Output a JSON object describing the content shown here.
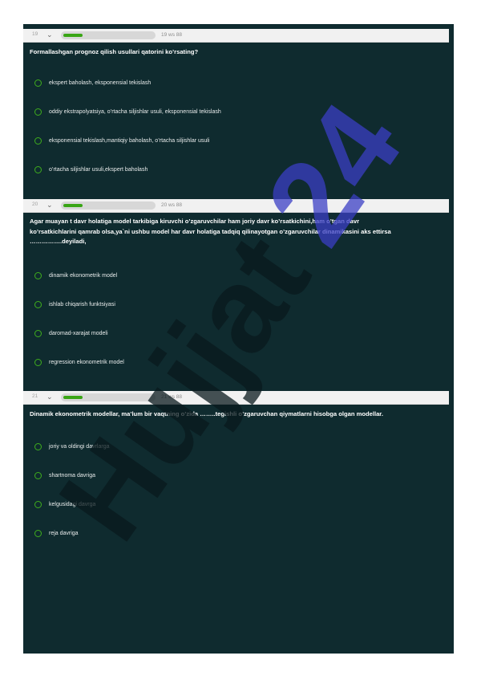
{
  "questions": [
    {
      "number": "19",
      "of_text": "19 ws 88",
      "progress": 0.2,
      "text": "Formallashgan prognoz qilish usullari qatorini ko’rsating?",
      "options": [
        "ekspert baholash, eksponensial tekislash",
        "oddiy ekstrapolyatsiya, o’rtacha siljishlar usuli, eksponensial tekislash",
        "eksponensial tekislash,mantiqiy baholash, o’rtacha siljishlar usuli",
        "o’rtacha siljishlar usuli,ekspert baholash"
      ]
    },
    {
      "number": "20",
      "of_text": "20 ws 88",
      "progress": 0.2,
      "text_lines": [
        "Agar muayan t davr holatiga model tarkibiga kiruvchi o’zgaruvchilar ham joriy davr ko’rsatkichini,ham o’tgan davr",
        "ko’rsatkichlarini qamrab olsa,ya`ni ushbu model har davr holatiga tadqiq qilinayotgan o’zgaruvchilar dinamikasini aks ettirsa",
        "…………….deyiladi,"
      ],
      "options": [
        "dinamik ekonometrik model",
        "ishlab chiqarish  funktsiyasi",
        "daromad-xarajat modeli",
        "regression ekonometrik model"
      ]
    },
    {
      "number": "21",
      "of_text": "21 ws 88",
      "progress": 0.2,
      "text": "Dinamik ekonometrik modellar, ma’lum bir vaqtning o’zida ……..tegishli o’zgaruvchan qiymatlarni hisobga olgan modellar.",
      "options": [
        "joriy va oldingi davrlarga",
        "shartnoma davriga",
        "kelgusidagi davrga",
        "reja davriga"
      ]
    }
  ],
  "watermark": {
    "text": "Hujjat24",
    "colors": {
      "dark": "#0a1a1d",
      "accent": "#3b3fc4"
    }
  },
  "colors": {
    "page_bg": "#0f2b2f",
    "radio": "#3fae1d",
    "progress": "#39a515"
  }
}
